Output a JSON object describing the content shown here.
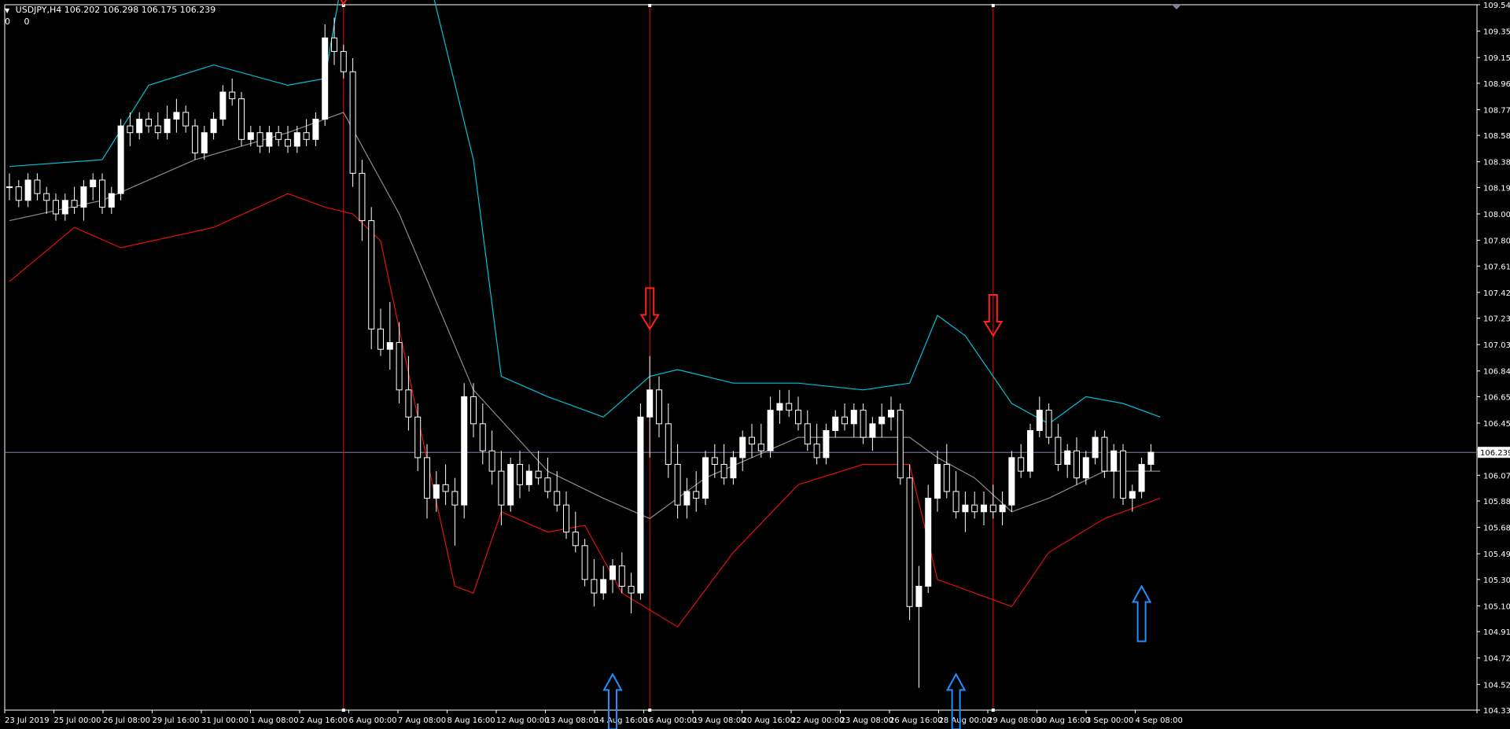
{
  "header": {
    "symbol_info": "USDJPY,H4",
    "ohlc": "106.202 106.298 106.175 106.239",
    "sub_values": [
      "0",
      "0"
    ]
  },
  "chart_data": {
    "type": "candlestick",
    "symbol": "USDJPY",
    "timeframe": "H4",
    "price_axis": {
      "ylim": [
        104.335,
        109.545
      ],
      "ticks": [
        109.545,
        109.35,
        109.155,
        108.965,
        108.77,
        108.58,
        108.385,
        108.195,
        108.0,
        107.805,
        107.615,
        107.42,
        107.23,
        107.035,
        106.84,
        106.65,
        106.455,
        106.26,
        106.07,
        105.88,
        105.685,
        105.49,
        105.3,
        105.105,
        104.915,
        104.72,
        104.525,
        104.335
      ],
      "current_price": 106.239
    },
    "time_axis": {
      "labels": [
        "23 Jul 2019",
        "25 Jul 00:00",
        "26 Jul 08:00",
        "29 Jul 16:00",
        "31 Jul 00:00",
        "1 Aug 08:00",
        "2 Aug 16:00",
        "6 Aug 00:00",
        "7 Aug 08:00",
        "8 Aug 16:00",
        "12 Aug 00:00",
        "13 Aug 08:00",
        "14 Aug 16:00",
        "16 Aug 00:00",
        "19 Aug 08:00",
        "20 Aug 16:00",
        "22 Aug 00:00",
        "23 Aug 08:00",
        "26 Aug 16:00",
        "28 Aug 00:00",
        "29 Aug 08:00",
        "30 Aug 16:00",
        "3 Sep 00:00",
        "4 Sep 08:00"
      ]
    },
    "candles": [
      [
        108.2,
        108.3,
        108.1,
        108.2
      ],
      [
        108.2,
        108.25,
        108.05,
        108.1
      ],
      [
        108.1,
        108.3,
        108.05,
        108.25
      ],
      [
        108.25,
        108.3,
        108.1,
        108.15
      ],
      [
        108.15,
        108.2,
        108.0,
        108.1
      ],
      [
        108.1,
        108.15,
        107.95,
        108.0
      ],
      [
        108.0,
        108.15,
        107.95,
        108.1
      ],
      [
        108.1,
        108.2,
        108.0,
        108.05
      ],
      [
        108.05,
        108.25,
        107.95,
        108.2
      ],
      [
        108.2,
        108.3,
        108.1,
        108.25
      ],
      [
        108.25,
        108.3,
        108.0,
        108.05
      ],
      [
        108.05,
        108.2,
        108.0,
        108.15
      ],
      [
        108.15,
        108.7,
        108.1,
        108.65
      ],
      [
        108.65,
        108.75,
        108.5,
        108.6
      ],
      [
        108.6,
        108.75,
        108.55,
        108.7
      ],
      [
        108.7,
        108.75,
        108.6,
        108.65
      ],
      [
        108.65,
        108.75,
        108.55,
        108.6
      ],
      [
        108.6,
        108.8,
        108.55,
        108.7
      ],
      [
        108.7,
        108.85,
        108.6,
        108.75
      ],
      [
        108.75,
        108.8,
        108.6,
        108.65
      ],
      [
        108.65,
        108.7,
        108.4,
        108.45
      ],
      [
        108.45,
        108.65,
        108.4,
        108.6
      ],
      [
        108.6,
        108.75,
        108.55,
        108.7
      ],
      [
        108.7,
        108.95,
        108.65,
        108.9
      ],
      [
        108.9,
        109.0,
        108.8,
        108.85
      ],
      [
        108.85,
        108.9,
        108.5,
        108.55
      ],
      [
        108.55,
        108.65,
        108.5,
        108.6
      ],
      [
        108.6,
        108.65,
        108.45,
        108.5
      ],
      [
        108.5,
        108.65,
        108.45,
        108.6
      ],
      [
        108.6,
        108.65,
        108.5,
        108.55
      ],
      [
        108.55,
        108.65,
        108.45,
        108.5
      ],
      [
        108.5,
        108.65,
        108.45,
        108.6
      ],
      [
        108.6,
        108.7,
        108.5,
        108.55
      ],
      [
        108.55,
        108.75,
        108.5,
        108.7
      ],
      [
        108.7,
        109.4,
        108.65,
        109.3
      ],
      [
        109.3,
        109.45,
        109.1,
        109.2
      ],
      [
        109.2,
        109.25,
        109.0,
        109.05
      ],
      [
        109.05,
        109.15,
        108.2,
        108.3
      ],
      [
        108.3,
        108.4,
        107.8,
        107.95
      ],
      [
        107.95,
        108.05,
        107.0,
        107.15
      ],
      [
        107.15,
        107.3,
        106.95,
        107.0
      ],
      [
        107.0,
        107.35,
        106.85,
        107.05
      ],
      [
        107.05,
        107.2,
        106.6,
        106.7
      ],
      [
        106.7,
        106.95,
        106.4,
        106.5
      ],
      [
        106.5,
        106.6,
        106.1,
        106.2
      ],
      [
        106.2,
        106.3,
        105.75,
        105.9
      ],
      [
        105.9,
        106.1,
        105.8,
        106.0
      ],
      [
        106.0,
        106.15,
        105.85,
        105.95
      ],
      [
        105.95,
        106.05,
        105.55,
        105.85
      ],
      [
        105.85,
        106.75,
        105.75,
        106.65
      ],
      [
        106.65,
        106.75,
        106.35,
        106.45
      ],
      [
        106.45,
        106.6,
        106.15,
        106.25
      ],
      [
        106.25,
        106.4,
        106.0,
        106.1
      ],
      [
        106.1,
        106.25,
        105.7,
        105.85
      ],
      [
        105.85,
        106.2,
        105.8,
        106.15
      ],
      [
        106.15,
        106.25,
        105.9,
        106.0
      ],
      [
        106.0,
        106.15,
        105.95,
        106.1
      ],
      [
        106.1,
        106.25,
        106.0,
        106.05
      ],
      [
        106.05,
        106.2,
        105.9,
        105.95
      ],
      [
        105.95,
        106.1,
        105.8,
        105.85
      ],
      [
        105.85,
        105.95,
        105.6,
        105.65
      ],
      [
        105.65,
        105.8,
        105.5,
        105.55
      ],
      [
        105.55,
        105.6,
        105.25,
        105.3
      ],
      [
        105.3,
        105.45,
        105.1,
        105.2
      ],
      [
        105.2,
        105.4,
        105.15,
        105.3
      ],
      [
        105.3,
        105.45,
        105.2,
        105.4
      ],
      [
        105.4,
        105.5,
        105.2,
        105.25
      ],
      [
        105.25,
        105.35,
        105.05,
        105.2
      ],
      [
        105.2,
        106.6,
        105.15,
        106.5
      ],
      [
        106.5,
        106.95,
        106.2,
        106.7
      ],
      [
        106.7,
        106.8,
        106.35,
        106.45
      ],
      [
        106.45,
        106.6,
        106.05,
        106.15
      ],
      [
        106.15,
        106.3,
        105.75,
        105.85
      ],
      [
        105.85,
        106.05,
        105.75,
        105.95
      ],
      [
        105.95,
        106.1,
        105.8,
        105.9
      ],
      [
        105.9,
        106.25,
        105.85,
        106.2
      ],
      [
        106.2,
        106.3,
        106.05,
        106.15
      ],
      [
        106.15,
        106.3,
        106.0,
        106.05
      ],
      [
        106.05,
        106.25,
        106.0,
        106.2
      ],
      [
        106.2,
        106.4,
        106.1,
        106.35
      ],
      [
        106.35,
        106.45,
        106.2,
        106.3
      ],
      [
        106.3,
        106.45,
        106.2,
        106.25
      ],
      [
        106.25,
        106.65,
        106.2,
        106.55
      ],
      [
        106.55,
        106.7,
        106.45,
        106.6
      ],
      [
        106.6,
        106.7,
        106.5,
        106.55
      ],
      [
        106.55,
        106.65,
        106.4,
        106.45
      ],
      [
        106.45,
        106.55,
        106.25,
        106.3
      ],
      [
        106.3,
        106.45,
        106.15,
        106.2
      ],
      [
        106.2,
        106.45,
        106.15,
        106.4
      ],
      [
        106.4,
        106.55,
        106.35,
        106.5
      ],
      [
        106.5,
        106.6,
        106.4,
        106.45
      ],
      [
        106.45,
        106.6,
        106.35,
        106.55
      ],
      [
        106.55,
        106.6,
        106.3,
        106.35
      ],
      [
        106.35,
        106.5,
        106.25,
        106.45
      ],
      [
        106.45,
        106.6,
        106.35,
        106.5
      ],
      [
        106.5,
        106.65,
        106.4,
        106.55
      ],
      [
        106.55,
        106.6,
        106.0,
        106.05
      ],
      [
        106.05,
        106.15,
        105.0,
        105.1
      ],
      [
        105.1,
        105.4,
        104.5,
        105.25
      ],
      [
        105.25,
        106.0,
        105.2,
        105.9
      ],
      [
        105.9,
        106.25,
        105.8,
        106.15
      ],
      [
        106.15,
        106.3,
        105.9,
        105.95
      ],
      [
        105.95,
        106.1,
        105.75,
        105.8
      ],
      [
        105.8,
        105.95,
        105.65,
        105.85
      ],
      [
        105.85,
        105.95,
        105.75,
        105.8
      ],
      [
        105.8,
        105.95,
        105.7,
        105.85
      ],
      [
        105.85,
        106.0,
        105.75,
        105.8
      ],
      [
        105.8,
        105.95,
        105.7,
        105.85
      ],
      [
        105.85,
        106.25,
        105.8,
        106.2
      ],
      [
        106.2,
        106.3,
        106.05,
        106.1
      ],
      [
        106.1,
        106.45,
        106.05,
        106.4
      ],
      [
        106.4,
        106.65,
        106.35,
        106.55
      ],
      [
        106.55,
        106.6,
        106.3,
        106.35
      ],
      [
        106.35,
        106.45,
        106.1,
        106.15
      ],
      [
        106.15,
        106.3,
        106.05,
        106.25
      ],
      [
        106.25,
        106.35,
        106.0,
        106.05
      ],
      [
        106.05,
        106.25,
        106.0,
        106.2
      ],
      [
        106.2,
        106.4,
        106.15,
        106.35
      ],
      [
        106.35,
        106.4,
        106.05,
        106.1
      ],
      [
        106.1,
        106.3,
        105.9,
        106.25
      ],
      [
        106.25,
        106.3,
        105.85,
        105.9
      ],
      [
        105.9,
        106.0,
        105.8,
        105.95
      ],
      [
        105.95,
        106.2,
        105.9,
        106.15
      ],
      [
        106.15,
        106.3,
        106.1,
        106.24
      ]
    ],
    "bollinger_bands": {
      "upper": [
        [
          0,
          108.35
        ],
        [
          10,
          108.4
        ],
        [
          15,
          108.95
        ],
        [
          22,
          109.1
        ],
        [
          30,
          108.95
        ],
        [
          34,
          109.0
        ],
        [
          36,
          109.8
        ],
        [
          45,
          109.8
        ],
        [
          50,
          108.4
        ],
        [
          53,
          106.8
        ],
        [
          58,
          106.65
        ],
        [
          64,
          106.5
        ],
        [
          69,
          106.8
        ],
        [
          72,
          106.85
        ],
        [
          78,
          106.75
        ],
        [
          85,
          106.75
        ],
        [
          92,
          106.7
        ],
        [
          97,
          106.75
        ],
        [
          100,
          107.25
        ],
        [
          103,
          107.1
        ],
        [
          108,
          106.6
        ],
        [
          112,
          106.45
        ],
        [
          116,
          106.65
        ],
        [
          120,
          106.6
        ],
        [
          124,
          106.5
        ]
      ],
      "middle": [
        [
          0,
          107.95
        ],
        [
          10,
          108.1
        ],
        [
          20,
          108.4
        ],
        [
          30,
          108.6
        ],
        [
          36,
          108.75
        ],
        [
          42,
          108.0
        ],
        [
          50,
          106.7
        ],
        [
          58,
          106.1
        ],
        [
          64,
          105.9
        ],
        [
          69,
          105.75
        ],
        [
          75,
          106.05
        ],
        [
          85,
          106.35
        ],
        [
          97,
          106.35
        ],
        [
          100,
          106.2
        ],
        [
          104,
          106.05
        ],
        [
          108,
          105.8
        ],
        [
          112,
          105.9
        ],
        [
          118,
          106.1
        ],
        [
          124,
          106.1
        ]
      ],
      "lower": [
        [
          0,
          107.5
        ],
        [
          7,
          107.9
        ],
        [
          12,
          107.75
        ],
        [
          22,
          107.9
        ],
        [
          30,
          108.15
        ],
        [
          34,
          108.05
        ],
        [
          37,
          108.0
        ],
        [
          40,
          107.8
        ],
        [
          44,
          106.5
        ],
        [
          48,
          105.25
        ],
        [
          50,
          105.2
        ],
        [
          53,
          105.8
        ],
        [
          58,
          105.65
        ],
        [
          62,
          105.7
        ],
        [
          66,
          105.2
        ],
        [
          72,
          104.95
        ],
        [
          78,
          105.5
        ],
        [
          85,
          106.0
        ],
        [
          92,
          106.15
        ],
        [
          97,
          106.15
        ],
        [
          100,
          105.3
        ],
        [
          104,
          105.2
        ],
        [
          108,
          105.1
        ],
        [
          112,
          105.5
        ],
        [
          118,
          105.75
        ],
        [
          124,
          105.9
        ]
      ]
    },
    "annotations": {
      "vertical_lines_at_candle": [
        36,
        69,
        106
      ],
      "down_arrows": [
        {
          "candle": 36,
          "price": 109.55
        },
        {
          "candle": 69,
          "price": 107.15
        },
        {
          "candle": 106,
          "price": 107.1
        }
      ],
      "up_arrows": [
        {
          "candle": 65,
          "price": 104.6
        },
        {
          "candle": 102,
          "price": 104.6
        },
        {
          "candle": 122,
          "price": 105.25
        }
      ]
    },
    "colors": {
      "background": "#000000",
      "bull_candle": "#ffffff",
      "bear_candle": "#000000",
      "candle_outline": "#ffffff",
      "upper_band": "#00c0d8",
      "middle_band": "#8c8c8c",
      "lower_band": "#e01010",
      "vertical_line": "#e01010",
      "down_arrow": "#ff2020",
      "up_arrow": "#1e90ff",
      "price_line": "#8080a0",
      "axis_text": "#ffffff"
    }
  }
}
